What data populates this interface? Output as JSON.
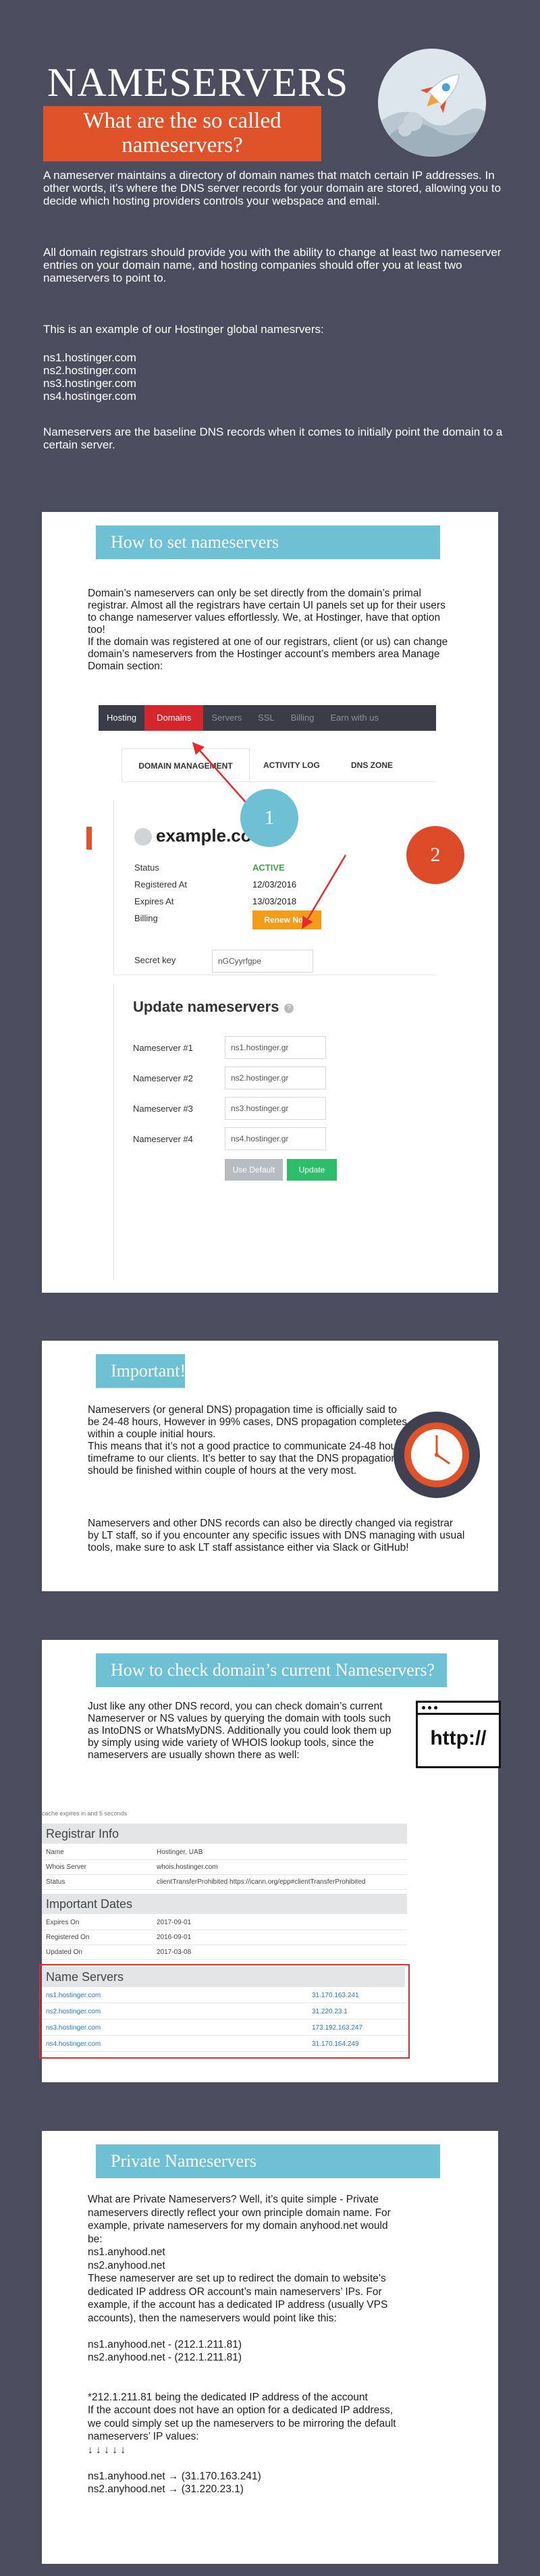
{
  "hero": {
    "title": "NAMESERVERS",
    "subtitle": "What are the so called nameservers?",
    "para1": "A nameserver maintains a directory of domain names that match certain IP addresses. In other words, it’s where the DNS server records for your domain are stored, allowing you to decide which hosting providers controls your webspace and email.",
    "para2": "All domain registrars should provide you with the ability to change at least two nameserver entries on your domain name, and hosting companies should offer you at least two nameservers to point to.",
    "para3": "This is an example of our Hostinger global namesrvers:",
    "ns_list": [
      "ns1.hostinger.com",
      "ns2.hostinger.com",
      "ns3.hostinger.com",
      "ns4.hostinger.com"
    ],
    "para4": "Nameservers are the baseline DNS records when it comes to initially point the domain to a certain server.",
    "badge_icon": "rocket-icon"
  },
  "set_section": {
    "title": "How to set nameservers",
    "text": "Domain’s nameservers can only be set directly from the domain’s primal registrar. Almost all the registrars have certain UI panels set up for their users to change nameserver values effortlessly. We, at Hostinger, have that option too!\nIf the domain was registered at one of our registrars, client (or us) can change domain’s nameservers from the Hostinger account’s members area Manage Domain section:",
    "nav_tabs": [
      "Hosting",
      "Domains",
      "Servers",
      "SSL",
      "Billing",
      "Earn with us"
    ],
    "sub_tabs": [
      "DOMAIN MANAGEMENT",
      "ACTIVITY LOG",
      "DNS ZONE"
    ],
    "domain": "example.com",
    "rows": [
      {
        "label": "Status",
        "value": "ACTIVE"
      },
      {
        "label": "Registered At",
        "value": "12/03/2016"
      },
      {
        "label": "Expires At",
        "value": "13/03/2018"
      },
      {
        "label": "Billing",
        "value": "Renew Now"
      }
    ],
    "secret_label": "Secret key",
    "secret_value": "nGCyyrfgpe",
    "update_title": "Update nameservers",
    "ns_rows": [
      {
        "label": "Nameserver #1",
        "value": "ns1.hostinger.gr"
      },
      {
        "label": "Nameserver #2",
        "value": "ns2.hostinger.gr"
      },
      {
        "label": "Nameserver #3",
        "value": "ns3.hostinger.gr"
      },
      {
        "label": "Nameserver #4",
        "value": "ns4.hostinger.gr"
      }
    ],
    "btn_default": "Use Default",
    "btn_update": "Update",
    "badge1": "1",
    "badge2": "2"
  },
  "important": {
    "title": "Important!",
    "para1": "Nameservers (or general DNS) propagation time is officially said to be 24-48 hours, However in 99% cases, DNS propagation completes within a couple initial hours.\nThis means that it’s not a good practice to communicate 24-48 hour timeframe to our clients. It’s better to say that the DNS propagation should be finished within couple of hours at the very most.",
    "para2": "Nameservers and other DNS records can also be directly changed via registrar by LT staff, so if you encounter any specific issues with DNS managing with usual tools, make sure to ask LT staff assistance either via Slack or GitHub!",
    "icon": "clock-icon"
  },
  "check": {
    "title": "How to check domain’s current Nameservers?",
    "text": "Just like any other DNS record, you can check domain’s current Nameserver or NS values by querying the domain with tools such as IntoDNS or WhatsMyDNS. Additionally you could look them up by simply using wide variety of WHOIS lookup tools, since the nameservers are usually shown there as well:",
    "browser_text": "http://",
    "cache_note": "cache expires in and 5 seconds",
    "registrar_head": "Registrar Info",
    "registrar_rows": [
      {
        "label": "Name",
        "value": "Hostinger, UAB"
      },
      {
        "label": "Whois Server",
        "value": "whois.hostinger.com"
      },
      {
        "label": "Status",
        "value": "clientTransferProhibited https://icann.org/epp#clientTransferProhibited"
      }
    ],
    "dates_head": "Important Dates",
    "dates_rows": [
      {
        "label": "Expires On",
        "value": "2017-09-01"
      },
      {
        "label": "Registered On",
        "value": "2016-09-01"
      },
      {
        "label": "Updated On",
        "value": "2017-03-08"
      }
    ],
    "ns_head": "Name Servers",
    "ns_rows": [
      {
        "name": "ns1.hostinger.com",
        "ip": "31.170.163.241"
      },
      {
        "name": "ns2.hostinger.com",
        "ip": "31.220.23.1"
      },
      {
        "name": "ns3.hostinger.com",
        "ip": "173.192.163.247"
      },
      {
        "name": "ns4.hostinger.com",
        "ip": "31.170.164.249"
      }
    ]
  },
  "private": {
    "title": "Private Nameservers",
    "lines": [
      "What are Private Nameservers? Well, it’s quite simple - Private",
      "nameservers directly reflect your own principle domain name. For",
      "example, private nameservers for my domain anyhood.net would",
      "be:",
      "ns1.anyhood.net",
      "ns2.anyhood.net",
      "These nameserver are set up to redirect the domain to website’s",
      "dedicated IP address OR account’s main nameservers’ IPs. For",
      "example, if the account has a dedicated IP address (usually VPS",
      "accounts), then the nameservers would point like this:",
      "",
      "ns1.anyhood.net - (212.1.211.81)",
      "ns2.anyhood.net - (212.1.211.81)",
      "",
      "",
      "*212.1.211.81 being the dedicated IP address of the account",
      "If the account does not have an option for a dedicated IP address,",
      "we could simply set up the nameservers to be mirroring the default",
      "nameservers’ IP values:",
      "↓ ↓ ↓ ↓ ↓",
      "",
      "ns1.anyhood.net → (31.170.163.241)",
      "ns2.anyhood.net → (31.220.23.1)"
    ]
  }
}
